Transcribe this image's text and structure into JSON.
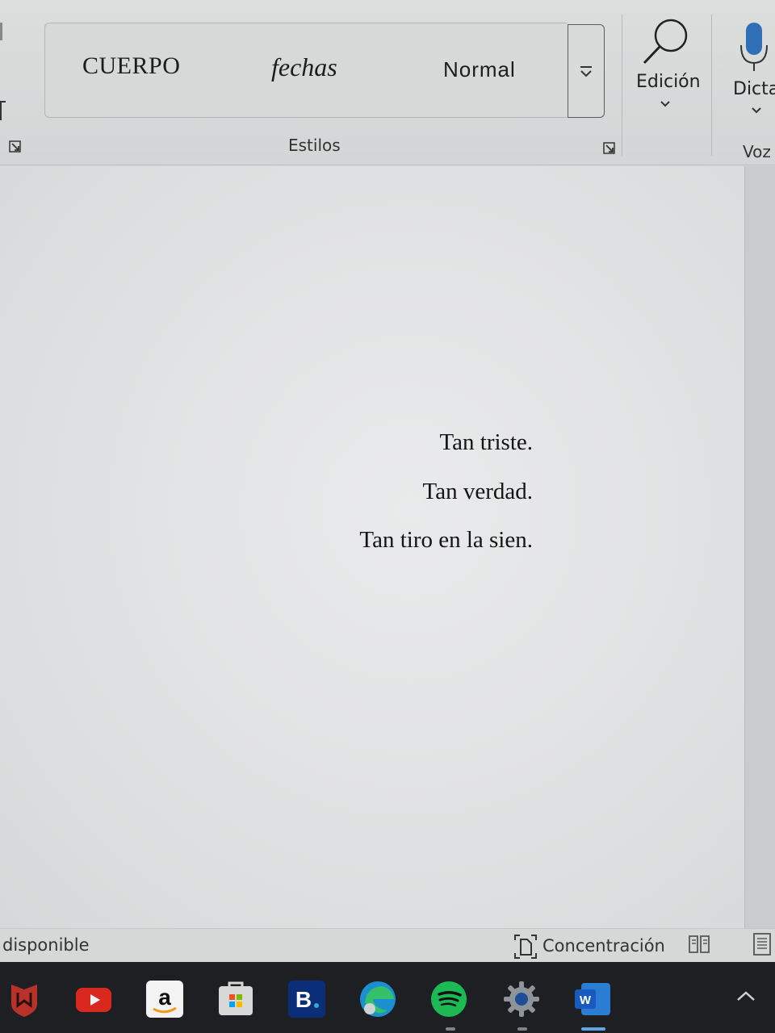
{
  "ribbon": {
    "styles_gallery": {
      "items": [
        {
          "label": "CUERPO"
        },
        {
          "label": "fechas"
        },
        {
          "label": "Normal"
        }
      ],
      "more_icon": "gallery-more-icon"
    },
    "styles_group_label": "Estilos",
    "editing": {
      "label": "Edición",
      "icon": "search-icon"
    },
    "dictate": {
      "label": "Dicta",
      "icon": "microphone-icon"
    },
    "voice_group_label": "Voz"
  },
  "document": {
    "lines": [
      "Tan triste.",
      "Tan verdad.",
      "Tan tiro en la sien."
    ]
  },
  "status_bar": {
    "left_text": "disponible",
    "focus_label": "Concentración",
    "focus_icon": "focus-icon",
    "read_mode_icon": "read-mode-icon",
    "print_layout_icon": "print-layout-icon"
  },
  "taskbar": {
    "apps": [
      {
        "name": "mcafee-icon",
        "color": "#c0392b"
      },
      {
        "name": "youtube-icon",
        "color": "#e62117"
      },
      {
        "name": "amazon-icon",
        "color": "#ffffff"
      },
      {
        "name": "microsoft-store-icon",
        "color": "#d9d9d9"
      },
      {
        "name": "booking-icon",
        "color": "#003580"
      },
      {
        "name": "edge-icon",
        "color": "#2bb0d6"
      },
      {
        "name": "spotify-icon",
        "color": "#1db954"
      },
      {
        "name": "settings-icon",
        "color": "#9aa0a6"
      },
      {
        "name": "word-icon",
        "color": "#185abd"
      }
    ],
    "tray_icon": "tray-chevron-icon"
  }
}
